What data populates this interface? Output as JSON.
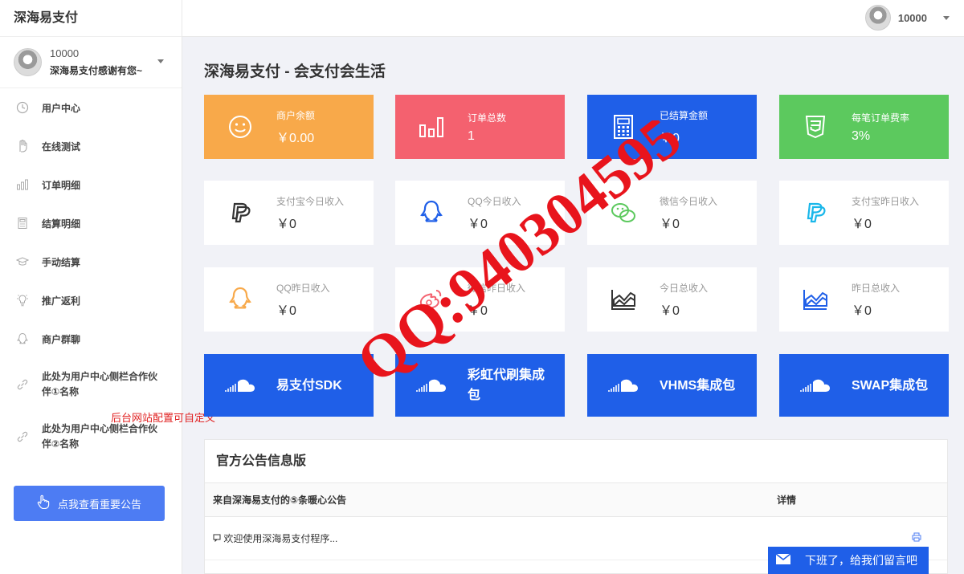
{
  "brand": "深海易支付",
  "profile": {
    "id": "10000",
    "message": "深海易支付感谢有您~"
  },
  "topbar": {
    "user_id": "10000"
  },
  "nav": [
    {
      "label": "用户中心",
      "icon": "clock-icon"
    },
    {
      "label": "在线测试",
      "icon": "hand-icon"
    },
    {
      "label": "订单明细",
      "icon": "bar-chart-icon"
    },
    {
      "label": "结算明细",
      "icon": "calculator-icon"
    },
    {
      "label": "手动结算",
      "icon": "graduation-cap-icon"
    },
    {
      "label": "推广返利",
      "icon": "lightbulb-icon"
    },
    {
      "label": "商户群聊",
      "icon": "qq-icon"
    },
    {
      "label": "此处为用户中心侧栏合作伙伴①名称",
      "icon": "link-icon"
    },
    {
      "label": "此处为用户中心侧栏合作伙伴②名称",
      "icon": "link-icon"
    }
  ],
  "side_note": "后台网站配置可自定义",
  "notice_button": "点我查看重要公告",
  "page_title": "深海易支付 - 会支付会生活",
  "stat_cards_colored": [
    {
      "label": "商户余额",
      "value": "￥0.00",
      "icon": "smile-icon",
      "color": "#f8a94a"
    },
    {
      "label": "订单总数",
      "value": "1",
      "icon": "bar-chart-icon",
      "color": "#f4616f"
    },
    {
      "label": "已结算金额",
      "value": "￥0",
      "icon": "calculator-icon",
      "color": "#1f5fe8"
    },
    {
      "label": "每笔订单费率",
      "value": "3%",
      "icon": "css3-icon",
      "color": "#5cc95e"
    }
  ],
  "stat_cards_white_row1": [
    {
      "label": "支付宝今日收入",
      "value": "￥0",
      "icon": "paypal-icon",
      "color": "#333333"
    },
    {
      "label": "QQ今日收入",
      "value": "￥0",
      "icon": "qq-icon",
      "color": "#1f5fe8"
    },
    {
      "label": "微信今日收入",
      "value": "￥0",
      "icon": "wechat-icon",
      "color": "#5cc95e"
    },
    {
      "label": "支付宝昨日收入",
      "value": "￥0",
      "icon": "paypal-icon",
      "color": "#1ab7ea"
    }
  ],
  "stat_cards_white_row2": [
    {
      "label": "QQ昨日收入",
      "value": "￥0",
      "icon": "qq-icon",
      "color": "#f8a94a"
    },
    {
      "label": "微信昨日收入",
      "value": "￥0",
      "icon": "weibo-icon",
      "color": "#f4616f"
    },
    {
      "label": "今日总收入",
      "value": "￥0",
      "icon": "area-chart-icon",
      "color": "#333333"
    },
    {
      "label": "昨日总收入",
      "value": "￥0",
      "icon": "area-chart-icon",
      "color": "#1f5fe8"
    }
  ],
  "sdk_buttons": [
    {
      "label": "易支付SDK"
    },
    {
      "label": "彩虹代刷集成包"
    },
    {
      "label": "VHMS集成包"
    },
    {
      "label": "SWAP集成包"
    }
  ],
  "board": {
    "title": "官方公告信息版",
    "col_title": "来自深海易支付的⑤条暖心公告",
    "col_detail": "详情",
    "rows": [
      {
        "text": "欢迎使用深海易支付程序..."
      }
    ]
  },
  "message_button": "下班了，给我们留言吧",
  "watermark": "QQ:940304595"
}
